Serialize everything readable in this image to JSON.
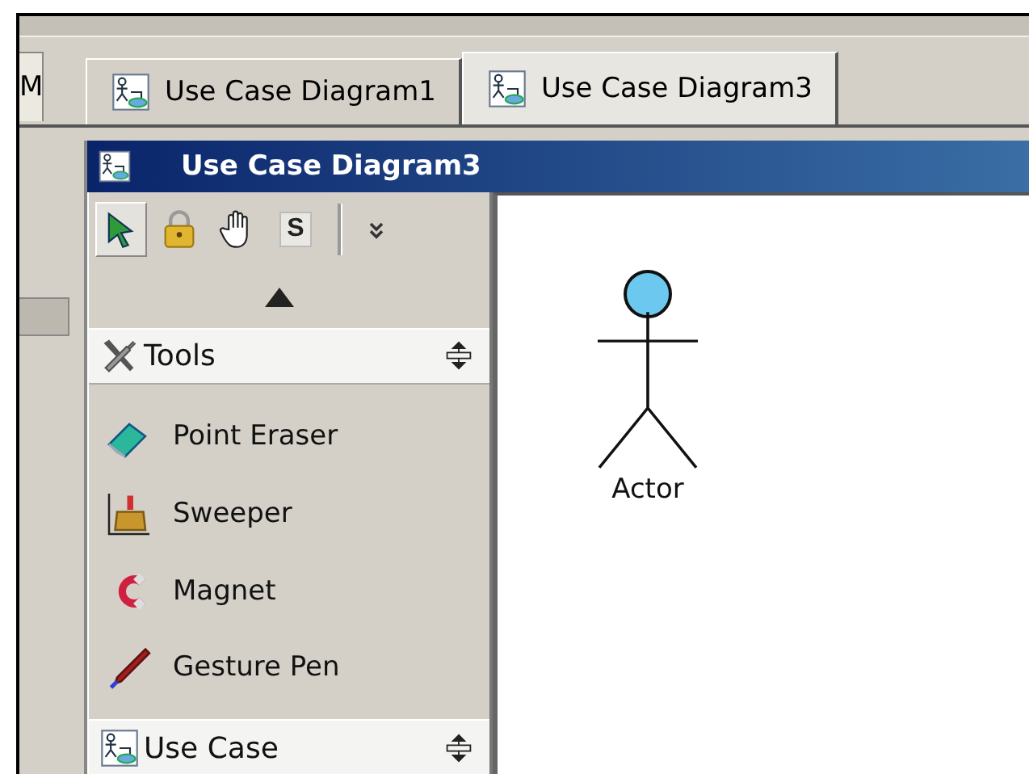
{
  "partial_tab": {
    "label": "M"
  },
  "tabs": [
    {
      "label": "Use Case Diagram1",
      "selected": false
    },
    {
      "label": "Use Case Diagram3",
      "selected": true
    }
  ],
  "window": {
    "title": "Use Case Diagram3"
  },
  "palette": {
    "toolbar": [
      {
        "kind": "pointer",
        "selected": true
      },
      {
        "kind": "lock",
        "selected": false
      },
      {
        "kind": "hand",
        "selected": false
      },
      {
        "kind": "text",
        "label": "S",
        "selected": false
      }
    ],
    "groups": [
      {
        "title": "Tools",
        "kind": "tools",
        "items": [
          {
            "label": "Point Eraser",
            "kind": "eraser"
          },
          {
            "label": "Sweeper",
            "kind": "sweeper"
          },
          {
            "label": "Magnet",
            "kind": "magnet"
          },
          {
            "label": "Gesture Pen",
            "kind": "pen"
          }
        ]
      },
      {
        "title": "Use Case",
        "kind": "usecase"
      }
    ]
  },
  "canvas": {
    "shapes": [
      {
        "kind": "actor",
        "label": "Actor"
      }
    ]
  }
}
